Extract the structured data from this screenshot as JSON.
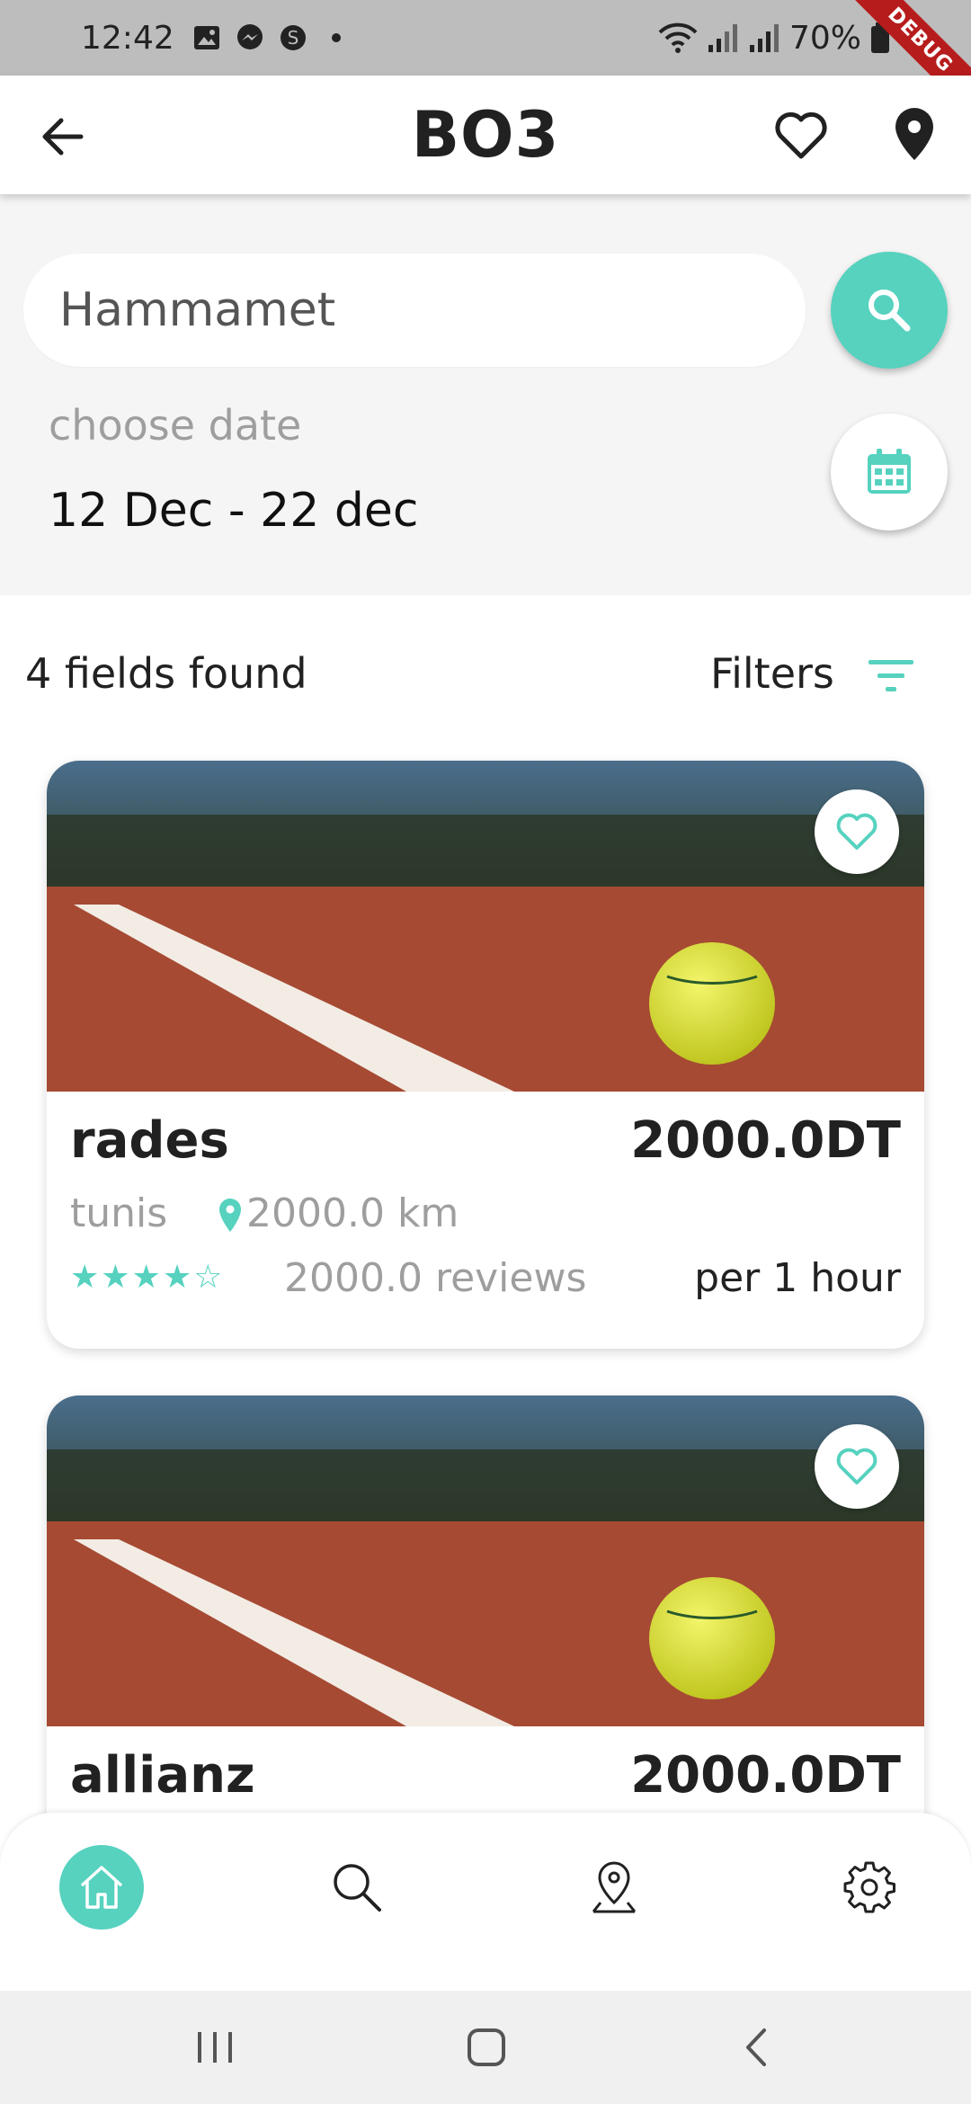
{
  "status_bar": {
    "time": "12:42",
    "battery": "70%",
    "debug_label": "DEBUG"
  },
  "app_bar": {
    "title": "BO3"
  },
  "search": {
    "value": "Hammamet",
    "placeholder": "Hammamet"
  },
  "date": {
    "label": "choose date",
    "value": "12 Dec - 22 dec"
  },
  "results": {
    "count_text": "4 fields found",
    "filters_label": "Filters"
  },
  "fields": [
    {
      "name": "rades",
      "price": "2000.0DT",
      "city": "tunis",
      "distance": "2000.0 km",
      "rating": 4,
      "rating_stars": "★★★★☆",
      "reviews": "2000.0 reviews",
      "per": "per 1 hour"
    },
    {
      "name": "allianz",
      "price": "2000.0DT"
    }
  ],
  "theme": {
    "accent": "#56d2bf"
  },
  "nav": {
    "items": [
      "home-icon",
      "search-icon",
      "location-pin-icon",
      "settings-gear-icon"
    ],
    "active": "home-icon"
  }
}
